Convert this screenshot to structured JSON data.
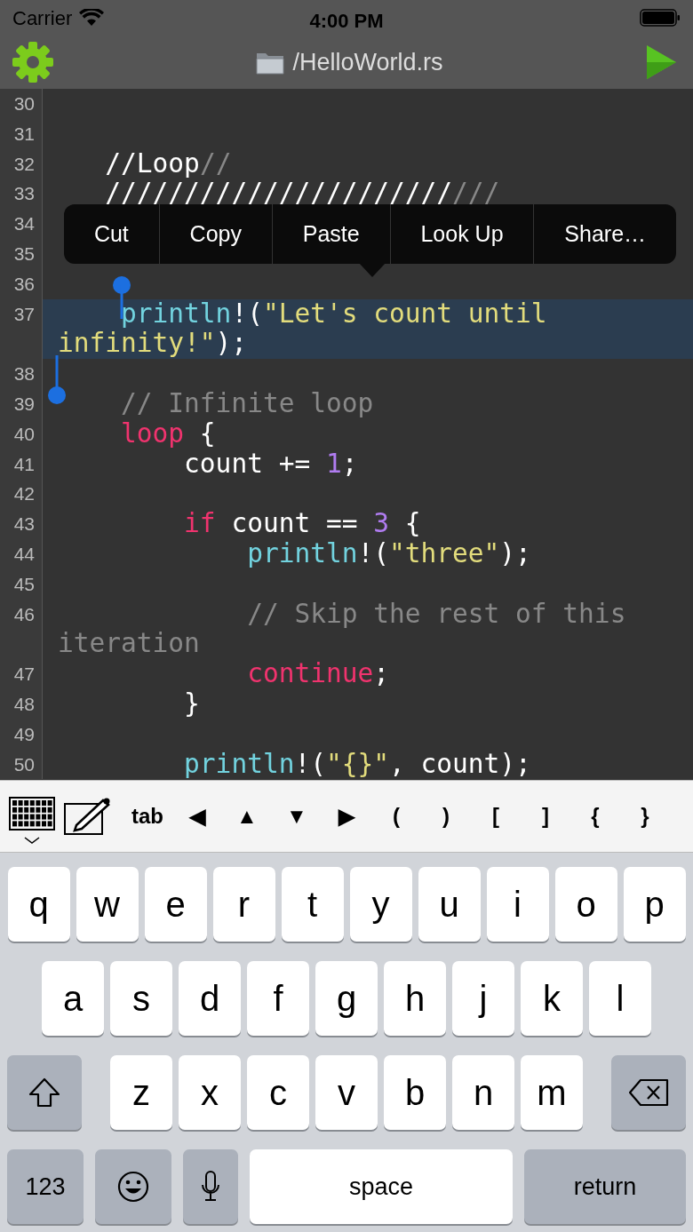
{
  "status_bar": {
    "carrier": "Carrier",
    "time": "4:00 PM"
  },
  "nav_bar": {
    "title": "/HelloWorld.rs"
  },
  "editor": {
    "lines": [
      {
        "number": "30",
        "selected": false
      },
      {
        "number": "31",
        "selected": false
      },
      {
        "number": "32",
        "selected": false,
        "tokens": [
          {
            "kind": "plain",
            "text": "   //Loop"
          },
          {
            "kind": "comment",
            "text": "//"
          }
        ]
      },
      {
        "number": "33",
        "selected": false,
        "tokens": [
          {
            "kind": "plain",
            "text": "   //////////////////////"
          },
          {
            "kind": "comment",
            "text": "///"
          }
        ]
      },
      {
        "number": "34",
        "selected": false
      },
      {
        "number": "35",
        "selected": false
      },
      {
        "number": "36",
        "selected": false
      },
      {
        "number": "37",
        "selected": true,
        "tokens": [
          {
            "kind": "macro",
            "text": "    println"
          },
          {
            "kind": "plain",
            "text": "!("
          },
          {
            "kind": "string",
            "text": "\"Let's count until infinity!\""
          },
          {
            "kind": "plain",
            "text": ");"
          }
        ]
      },
      {
        "number": "38",
        "selected": false
      },
      {
        "number": "39",
        "selected": false,
        "tokens": [
          {
            "kind": "comment",
            "text": "    // Infinite loop"
          }
        ]
      },
      {
        "number": "40",
        "selected": false,
        "tokens": [
          {
            "kind": "keyword",
            "text": "    loop"
          },
          {
            "kind": "plain",
            "text": " {"
          }
        ]
      },
      {
        "number": "41",
        "selected": false,
        "tokens": [
          {
            "kind": "plain",
            "text": "        count += "
          },
          {
            "kind": "number",
            "text": "1"
          },
          {
            "kind": "plain",
            "text": ";"
          }
        ]
      },
      {
        "number": "42",
        "selected": false
      },
      {
        "number": "43",
        "selected": false,
        "tokens": [
          {
            "kind": "keyword",
            "text": "        if"
          },
          {
            "kind": "plain",
            "text": " count == "
          },
          {
            "kind": "number",
            "text": "3"
          },
          {
            "kind": "plain",
            "text": " {"
          }
        ]
      },
      {
        "number": "44",
        "selected": false,
        "tokens": [
          {
            "kind": "macro",
            "text": "            println"
          },
          {
            "kind": "plain",
            "text": "!("
          },
          {
            "kind": "string",
            "text": "\"three\""
          },
          {
            "kind": "plain",
            "text": ");"
          }
        ]
      },
      {
        "number": "45",
        "selected": false
      },
      {
        "number": "46",
        "selected": false,
        "tokens": [
          {
            "kind": "comment",
            "text": "            // Skip the rest of this iteration"
          }
        ]
      },
      {
        "number": "47",
        "selected": false,
        "tokens": [
          {
            "kind": "keyword",
            "text": "            continue"
          },
          {
            "kind": "plain",
            "text": ";"
          }
        ]
      },
      {
        "number": "48",
        "selected": false,
        "tokens": [
          {
            "kind": "plain",
            "text": "        }"
          }
        ]
      },
      {
        "number": "49",
        "selected": false
      },
      {
        "number": "50",
        "selected": false,
        "tokens": [
          {
            "kind": "macro",
            "text": "        println"
          },
          {
            "kind": "plain",
            "text": "!("
          },
          {
            "kind": "string",
            "text": "\"{}\""
          },
          {
            "kind": "plain",
            "text": ", count);"
          }
        ]
      }
    ]
  },
  "context_menu": {
    "items": [
      "Cut",
      "Copy",
      "Paste",
      "Look Up",
      "Share…"
    ]
  },
  "accessory_bar": {
    "items": [
      {
        "kind": "keyboard"
      },
      {
        "kind": "edit"
      },
      {
        "kind": "text",
        "label": "tab"
      },
      {
        "kind": "text",
        "label": "◀"
      },
      {
        "kind": "text",
        "label": "▲"
      },
      {
        "kind": "text",
        "label": "▼"
      },
      {
        "kind": "text",
        "label": "▶"
      },
      {
        "kind": "text",
        "label": "("
      },
      {
        "kind": "text",
        "label": ")"
      },
      {
        "kind": "text",
        "label": "["
      },
      {
        "kind": "text",
        "label": "]"
      },
      {
        "kind": "text",
        "label": "{"
      },
      {
        "kind": "text",
        "label": "}"
      }
    ]
  },
  "keyboard": {
    "rows": [
      {
        "keys": [
          {
            "kind": "letter",
            "label": "q"
          },
          {
            "kind": "letter",
            "label": "w"
          },
          {
            "kind": "letter",
            "label": "e"
          },
          {
            "kind": "letter",
            "label": "r"
          },
          {
            "kind": "letter",
            "label": "t"
          },
          {
            "kind": "letter",
            "label": "y"
          },
          {
            "kind": "letter",
            "label": "u"
          },
          {
            "kind": "letter",
            "label": "i"
          },
          {
            "kind": "letter",
            "label": "o"
          },
          {
            "kind": "letter",
            "label": "p"
          }
        ]
      },
      {
        "keys": [
          {
            "kind": "letter",
            "label": "a"
          },
          {
            "kind": "letter",
            "label": "s"
          },
          {
            "kind": "letter",
            "label": "d"
          },
          {
            "kind": "letter",
            "label": "f"
          },
          {
            "kind": "letter",
            "label": "g"
          },
          {
            "kind": "letter",
            "label": "h"
          },
          {
            "kind": "letter",
            "label": "j"
          },
          {
            "kind": "letter",
            "label": "k"
          },
          {
            "kind": "letter",
            "label": "l"
          }
        ]
      },
      {
        "keys": [
          {
            "kind": "shift"
          },
          {
            "kind": "letter",
            "label": "z"
          },
          {
            "kind": "letter",
            "label": "x"
          },
          {
            "kind": "letter",
            "label": "c"
          },
          {
            "kind": "letter",
            "label": "v"
          },
          {
            "kind": "letter",
            "label": "b"
          },
          {
            "kind": "letter",
            "label": "n"
          },
          {
            "kind": "letter",
            "label": "m"
          },
          {
            "kind": "delete"
          }
        ]
      },
      {
        "keys": [
          {
            "kind": "numbers",
            "label": "123"
          },
          {
            "kind": "emoji"
          },
          {
            "kind": "mic"
          },
          {
            "kind": "space",
            "label": "space"
          },
          {
            "kind": "return",
            "label": "return"
          }
        ]
      }
    ]
  }
}
